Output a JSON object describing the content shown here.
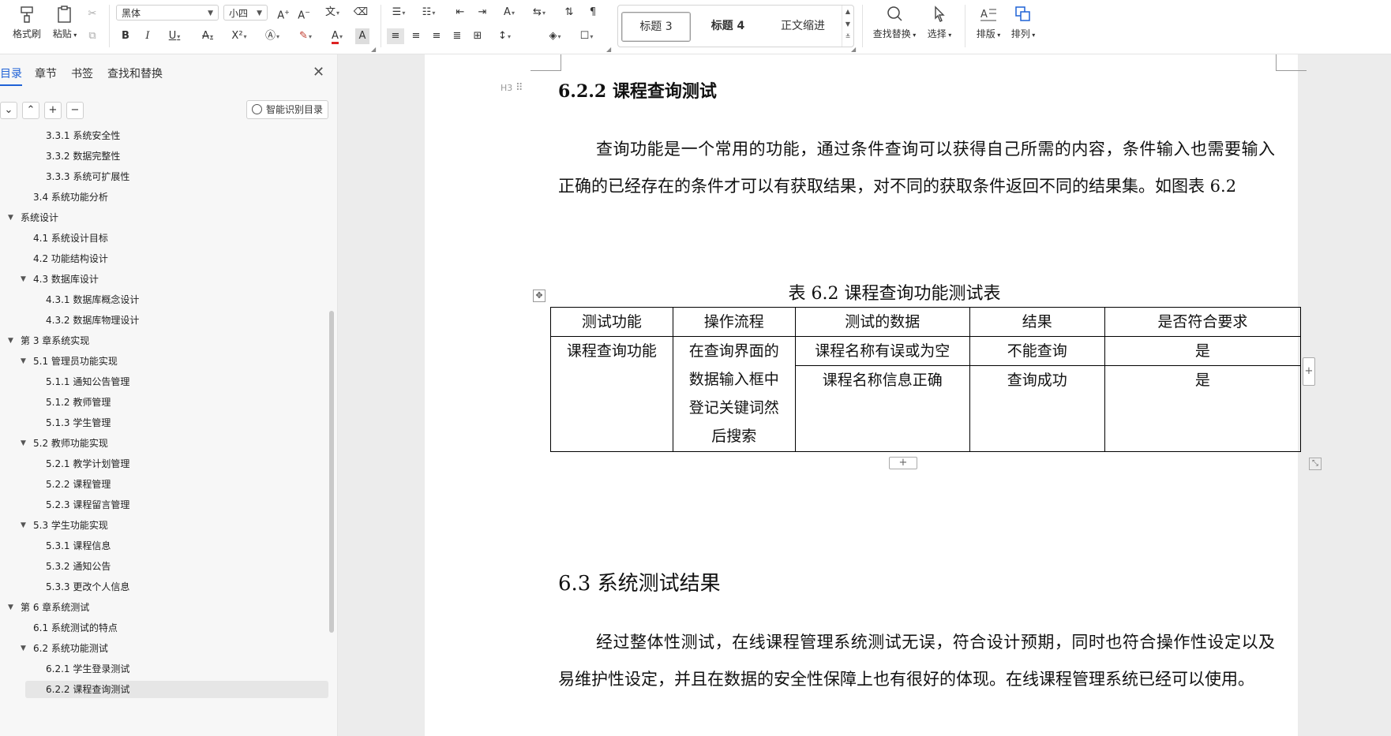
{
  "toolbar": {
    "format_painter": "格式刷",
    "paste": "粘贴",
    "font_name": "黑体",
    "font_size": "小四",
    "styles": [
      "标题 3",
      "标题 4",
      "正文缩进"
    ],
    "find_replace": "查找替换",
    "select": "选择",
    "layout": "排版",
    "arrange": "排列",
    "accent_color": "#1f62d6"
  },
  "sidebar": {
    "tabs": [
      "目录",
      "章节",
      "书签",
      "查找和替换"
    ],
    "smart_toc_button": "智能识别目录",
    "toc": [
      {
        "label": "3.3.1 系统安全性",
        "level": 3
      },
      {
        "label": "3.3.2 数据完整性",
        "level": 3
      },
      {
        "label": "3.3.3 系统可扩展性",
        "level": 3
      },
      {
        "label": "3.4 系统功能分析",
        "level": 2
      },
      {
        "label": "系统设计",
        "level": 1,
        "expanded": true
      },
      {
        "label": "4.1  系统设计目标",
        "level": 2
      },
      {
        "label": "4.2 功能结构设计",
        "level": 2
      },
      {
        "label": "4.3 数据库设计",
        "level": 2,
        "expanded": true
      },
      {
        "label": "4.3.1  数据库概念设计",
        "level": 3
      },
      {
        "label": "4.3.2  数据库物理设计",
        "level": 3
      },
      {
        "label": "第 3 章系统实现",
        "level": 1,
        "expanded": true
      },
      {
        "label": "5.1 管理员功能实现",
        "level": 2,
        "expanded": true
      },
      {
        "label": "5.1.1  通知公告管理",
        "level": 3
      },
      {
        "label": "5.1.2  教师管理",
        "level": 3
      },
      {
        "label": "5.1.3  学生管理",
        "level": 3
      },
      {
        "label": "5.2  教师功能实现",
        "level": 2,
        "expanded": true
      },
      {
        "label": "5.2.1  教学计划管理",
        "level": 3
      },
      {
        "label": "5.2.2  课程管理",
        "level": 3
      },
      {
        "label": "5.2.3  课程留言管理",
        "level": 3
      },
      {
        "label": "5.3  学生功能实现",
        "level": 2,
        "expanded": true
      },
      {
        "label": "5.3.1  课程信息",
        "level": 3
      },
      {
        "label": "5.3.2  通知公告",
        "level": 3
      },
      {
        "label": "5.3.3  更改个人信息",
        "level": 3
      },
      {
        "label": "第 6 章系统测试",
        "level": 1,
        "expanded": true
      },
      {
        "label": "6.1 系统测试的特点",
        "level": 2
      },
      {
        "label": "6.2  系统功能测试",
        "level": 2,
        "expanded": true
      },
      {
        "label": "6.2.1  学生登录测试",
        "level": 3
      },
      {
        "label": "6.2.2  课程查询测试",
        "level": 3,
        "current": true
      }
    ]
  },
  "document": {
    "heading_marker": "H3",
    "section_622": "6.2.2  课程查询测试",
    "para1": "查询功能是一个常用的功能，通过条件查询可以获得自己所需的内容，条件输入也需要输入正确的已经存在的条件才可以有获取结果，对不同的获取条件返回不同的结果集。如图表 6.2",
    "table_caption": "表 6.2  课程查询功能测试表",
    "table": {
      "headers": [
        "测试功能",
        "操作流程",
        "测试的数据",
        "结果",
        "是否符合要求"
      ],
      "function": "课程查询功能",
      "process": [
        "在查询界面的",
        "数据输入框中",
        "登记关键词然",
        "后搜索"
      ],
      "rows": [
        {
          "data": "课程名称有误或为空",
          "result": "不能查询",
          "ok": "是"
        },
        {
          "data": "课程名称信息正确",
          "result": "查询成功",
          "ok": "是"
        }
      ]
    },
    "section_63": "6.3  系统测试结果",
    "para2": "经过整体性测试，在线课程管理系统测试无误，符合设计预期，同时也符合操作性设定以及易维护性设定，并且在数据的安全性保障上也有很好的体现。在线课程管理系统已经可以使用。"
  }
}
